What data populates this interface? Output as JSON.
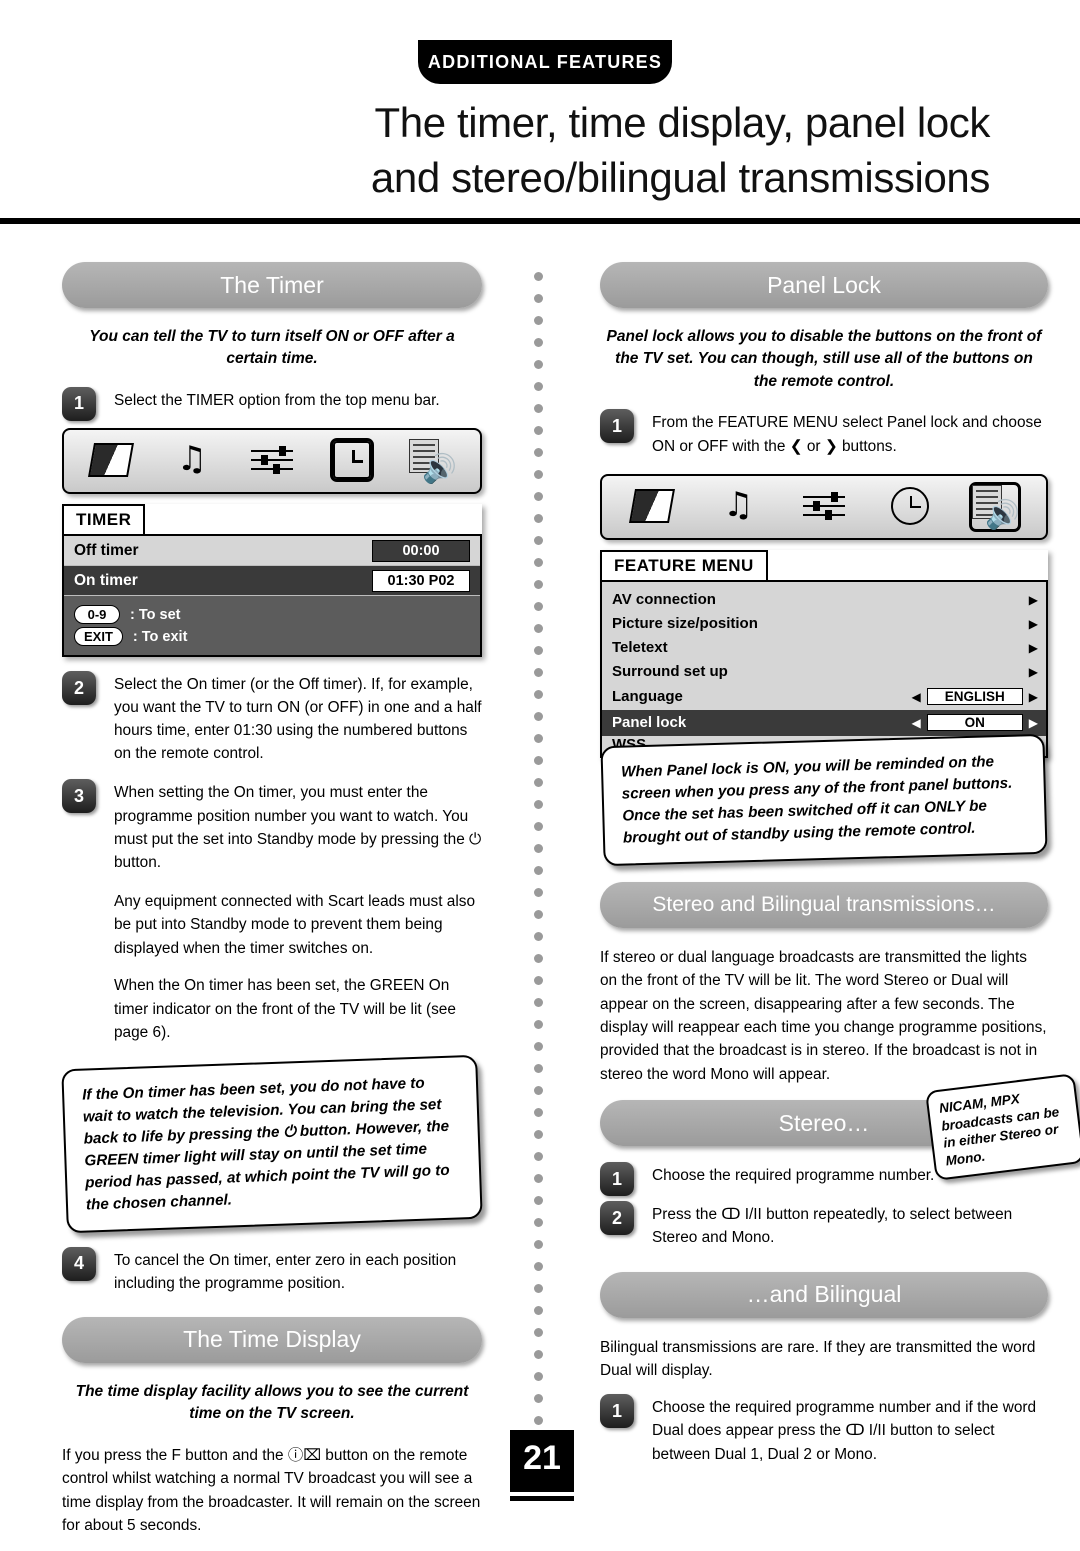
{
  "header": {
    "tab": "ADDITIONAL FEATURES",
    "title_line1": "The timer, time display, panel lock",
    "title_line2": "and stereo/bilingual transmissions"
  },
  "page_number": "21",
  "left": {
    "timer_section": {
      "pill": "The Timer",
      "intro": "You can tell the TV to turn itself ON or OFF after a certain time.",
      "intro_on": "ON",
      "intro_or": " or ",
      "intro_off": "OFF",
      "steps": [
        {
          "num": "1",
          "text": "Select the TIMER option from the top menu bar."
        },
        {
          "num": "2",
          "text": "Select the On timer (or the Off timer). If, for example, you want the TV to turn ON (or OFF) in one and a half hours time, enter 01:30 using the numbered buttons on the remote control."
        },
        {
          "num": "3",
          "text": "When setting the On timer, you must enter the programme position number you want to watch. You must put the set into Standby mode by pressing the ⏻ button."
        },
        {
          "num": "4",
          "text": "To cancel the On timer, enter zero in each position including the programme position."
        }
      ],
      "osd": {
        "title": "TIMER",
        "rows": [
          {
            "label": "Off timer",
            "value": "00:00",
            "selected": false
          },
          {
            "label": "On timer",
            "value": "01:30  P02",
            "selected": true
          }
        ],
        "footer": [
          {
            "key": "0-9",
            "text": ": To set"
          },
          {
            "key": "EXIT",
            "text": ": To exit"
          }
        ]
      },
      "paragraphs": [
        "Any equipment connected with Scart leads must also be put into Standby mode to prevent them being displayed when the timer switches on.",
        "When the On timer has been set, the GREEN On timer indicator on the front of the TV will be lit (see page 6)."
      ],
      "callout": "If the On timer has been set, you do not have to wait to watch the television. You can bring the set back to life by pressing the ⏻ button. However, the GREEN timer light will stay on until the set time period has passed, at which point the TV will go to the chosen channel."
    },
    "time_display_section": {
      "pill": "The Time Display",
      "intro": "The time display facility allows you to see the current time on the TV screen.",
      "body": "If you press the F button and the ⓘ⌧ button on the remote control whilst watching a normal TV broadcast you will see a time display from the broadcaster. It will remain on the screen for about 5 seconds."
    }
  },
  "right": {
    "panel_lock_section": {
      "pill": "Panel Lock",
      "intro": "Panel lock allows you to disable the buttons on the front of the TV set. You can though, still use all of the buttons on the remote control.",
      "step": {
        "num": "1",
        "text": "From the FEATURE MENU select Panel lock and choose ON or OFF with the ❮ or ❯ buttons."
      },
      "menu": {
        "title": "FEATURE MENU",
        "items": [
          {
            "label": "AV connection",
            "value": "",
            "arrow": true,
            "selected": false
          },
          {
            "label": "Picture size/position",
            "value": "",
            "arrow": true,
            "selected": false
          },
          {
            "label": "Teletext",
            "value": "",
            "arrow": true,
            "selected": false
          },
          {
            "label": "Surround set up",
            "value": "",
            "arrow": true,
            "selected": false
          },
          {
            "label": "Language",
            "value": "ENGLISH",
            "arrow": false,
            "selected": false
          },
          {
            "label": "Panel lock",
            "value": "ON",
            "arrow": false,
            "selected": true
          },
          {
            "label": "WSS",
            "value": "",
            "arrow": false,
            "selected": false
          }
        ]
      },
      "callout": "When Panel lock is ON, you will be reminded on the screen when you press any of the front panel buttons. Once the set has been switched off it can ONLY be brought out of standby using the remote control."
    },
    "stereo_section": {
      "pill": "Stereo and Bilingual transmissions…",
      "body": "If stereo or dual language broadcasts are transmitted the lights on the front of the TV will be lit. The word Stereo or Dual will appear on the screen, disappearing after a few seconds. The display will reappear each time you change programme positions, provided that the broadcast is in stereo. If the broadcast is not in stereo the word Mono will appear.",
      "nicam_note": "NICAM, MPX broadcasts can be in either Stereo or Mono.",
      "sub_pill": "Stereo…",
      "steps": [
        {
          "num": "1",
          "text": "Choose the required programme number."
        },
        {
          "num": "2",
          "text": "Press the ↀ I/II button repeatedly, to select between Stereo and Mono."
        }
      ]
    },
    "bilingual_section": {
      "pill": "…and Bilingual",
      "body": "Bilingual transmissions are rare. If they are transmitted the word Dual will display.",
      "step": {
        "num": "1",
        "text": "Choose the required programme number and if the word Dual does appear press the ↀ I/II button to select between Dual 1, Dual 2 or Mono."
      }
    }
  }
}
